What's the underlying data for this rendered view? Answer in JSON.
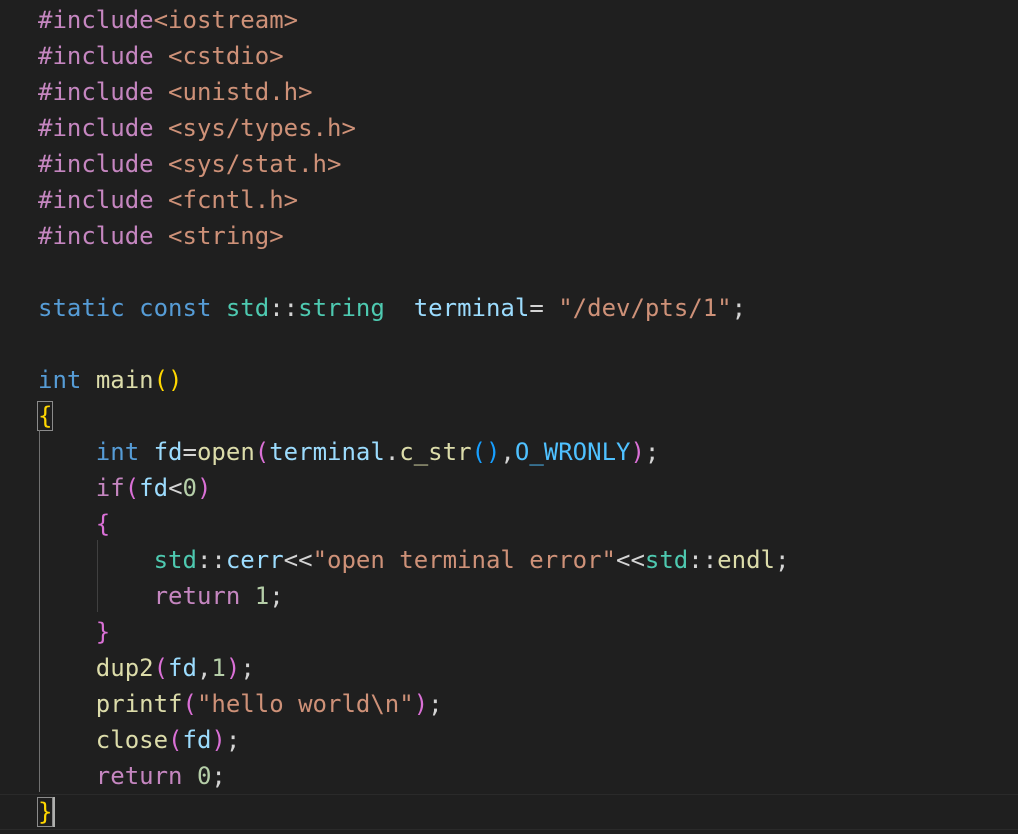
{
  "code": {
    "lines": [
      [
        {
          "t": "#include",
          "c": "pp"
        },
        {
          "t": "<iostream>",
          "c": "str"
        }
      ],
      [
        {
          "t": "#include",
          "c": "pp"
        },
        {
          "t": " ",
          "c": "plain"
        },
        {
          "t": "<cstdio>",
          "c": "str"
        }
      ],
      [
        {
          "t": "#include",
          "c": "pp"
        },
        {
          "t": " ",
          "c": "plain"
        },
        {
          "t": "<unistd.h>",
          "c": "str"
        }
      ],
      [
        {
          "t": "#include",
          "c": "pp"
        },
        {
          "t": " ",
          "c": "plain"
        },
        {
          "t": "<sys/types.h>",
          "c": "str"
        }
      ],
      [
        {
          "t": "#include",
          "c": "pp"
        },
        {
          "t": " ",
          "c": "plain"
        },
        {
          "t": "<sys/stat.h>",
          "c": "str"
        }
      ],
      [
        {
          "t": "#include",
          "c": "pp"
        },
        {
          "t": " ",
          "c": "plain"
        },
        {
          "t": "<fcntl.h>",
          "c": "str"
        }
      ],
      [
        {
          "t": "#include",
          "c": "pp"
        },
        {
          "t": " ",
          "c": "plain"
        },
        {
          "t": "<string>",
          "c": "str"
        }
      ],
      [],
      [
        {
          "t": "static",
          "c": "kw"
        },
        {
          "t": " ",
          "c": "plain"
        },
        {
          "t": "const",
          "c": "kw"
        },
        {
          "t": " ",
          "c": "plain"
        },
        {
          "t": "std",
          "c": "type"
        },
        {
          "t": "::",
          "c": "plain"
        },
        {
          "t": "string",
          "c": "type"
        },
        {
          "t": "  ",
          "c": "plain"
        },
        {
          "t": "terminal",
          "c": "var"
        },
        {
          "t": "=",
          "c": "plain"
        },
        {
          "t": " ",
          "c": "plain"
        },
        {
          "t": "\"/dev/pts/1\"",
          "c": "str"
        },
        {
          "t": ";",
          "c": "plain"
        }
      ],
      [],
      [
        {
          "t": "int",
          "c": "kw"
        },
        {
          "t": " ",
          "c": "plain"
        },
        {
          "t": "main",
          "c": "fn"
        },
        {
          "t": "()",
          "c": "br1"
        }
      ],
      [
        {
          "t": "{",
          "c": "br1",
          "box": true
        }
      ],
      [
        {
          "t": "    ",
          "c": "plain"
        },
        {
          "t": "int",
          "c": "kw"
        },
        {
          "t": " ",
          "c": "plain"
        },
        {
          "t": "fd",
          "c": "var"
        },
        {
          "t": "=",
          "c": "plain"
        },
        {
          "t": "open",
          "c": "fn"
        },
        {
          "t": "(",
          "c": "br2"
        },
        {
          "t": "terminal",
          "c": "var"
        },
        {
          "t": ".",
          "c": "plain"
        },
        {
          "t": "c_str",
          "c": "fn"
        },
        {
          "t": "()",
          "c": "br3"
        },
        {
          "t": ",",
          "c": "plain"
        },
        {
          "t": "O_WRONLY",
          "c": "const"
        },
        {
          "t": ")",
          "c": "br2"
        },
        {
          "t": ";",
          "c": "plain"
        }
      ],
      [
        {
          "t": "    ",
          "c": "plain"
        },
        {
          "t": "if",
          "c": "ctl"
        },
        {
          "t": "(",
          "c": "br2"
        },
        {
          "t": "fd",
          "c": "var"
        },
        {
          "t": "<",
          "c": "plain"
        },
        {
          "t": "0",
          "c": "num"
        },
        {
          "t": ")",
          "c": "br2"
        }
      ],
      [
        {
          "t": "    ",
          "c": "plain"
        },
        {
          "t": "{",
          "c": "br2"
        }
      ],
      [
        {
          "t": "        ",
          "c": "plain"
        },
        {
          "t": "std",
          "c": "type"
        },
        {
          "t": "::",
          "c": "plain"
        },
        {
          "t": "cerr",
          "c": "var"
        },
        {
          "t": "<<",
          "c": "plain"
        },
        {
          "t": "\"open terminal error\"",
          "c": "str"
        },
        {
          "t": "<<",
          "c": "plain"
        },
        {
          "t": "std",
          "c": "type"
        },
        {
          "t": "::",
          "c": "plain"
        },
        {
          "t": "endl",
          "c": "fn"
        },
        {
          "t": ";",
          "c": "plain"
        }
      ],
      [
        {
          "t": "        ",
          "c": "plain"
        },
        {
          "t": "return",
          "c": "ctl"
        },
        {
          "t": " ",
          "c": "plain"
        },
        {
          "t": "1",
          "c": "num"
        },
        {
          "t": ";",
          "c": "plain"
        }
      ],
      [
        {
          "t": "    ",
          "c": "plain"
        },
        {
          "t": "}",
          "c": "br2"
        }
      ],
      [
        {
          "t": "    ",
          "c": "plain"
        },
        {
          "t": "dup2",
          "c": "fn"
        },
        {
          "t": "(",
          "c": "br2"
        },
        {
          "t": "fd",
          "c": "var"
        },
        {
          "t": ",",
          "c": "plain"
        },
        {
          "t": "1",
          "c": "num"
        },
        {
          "t": ")",
          "c": "br2"
        },
        {
          "t": ";",
          "c": "plain"
        }
      ],
      [
        {
          "t": "    ",
          "c": "plain"
        },
        {
          "t": "printf",
          "c": "fn"
        },
        {
          "t": "(",
          "c": "br2"
        },
        {
          "t": "\"hello world\\n\"",
          "c": "str"
        },
        {
          "t": ")",
          "c": "br2"
        },
        {
          "t": ";",
          "c": "plain"
        }
      ],
      [
        {
          "t": "    ",
          "c": "plain"
        },
        {
          "t": "close",
          "c": "fn"
        },
        {
          "t": "(",
          "c": "br2"
        },
        {
          "t": "fd",
          "c": "var"
        },
        {
          "t": ")",
          "c": "br2"
        },
        {
          "t": ";",
          "c": "plain"
        }
      ],
      [
        {
          "t": "    ",
          "c": "plain"
        },
        {
          "t": "return",
          "c": "ctl"
        },
        {
          "t": " ",
          "c": "plain"
        },
        {
          "t": "0",
          "c": "num"
        },
        {
          "t": ";",
          "c": "plain"
        }
      ],
      [
        {
          "t": "}",
          "c": "br1",
          "box": true
        }
      ]
    ]
  }
}
